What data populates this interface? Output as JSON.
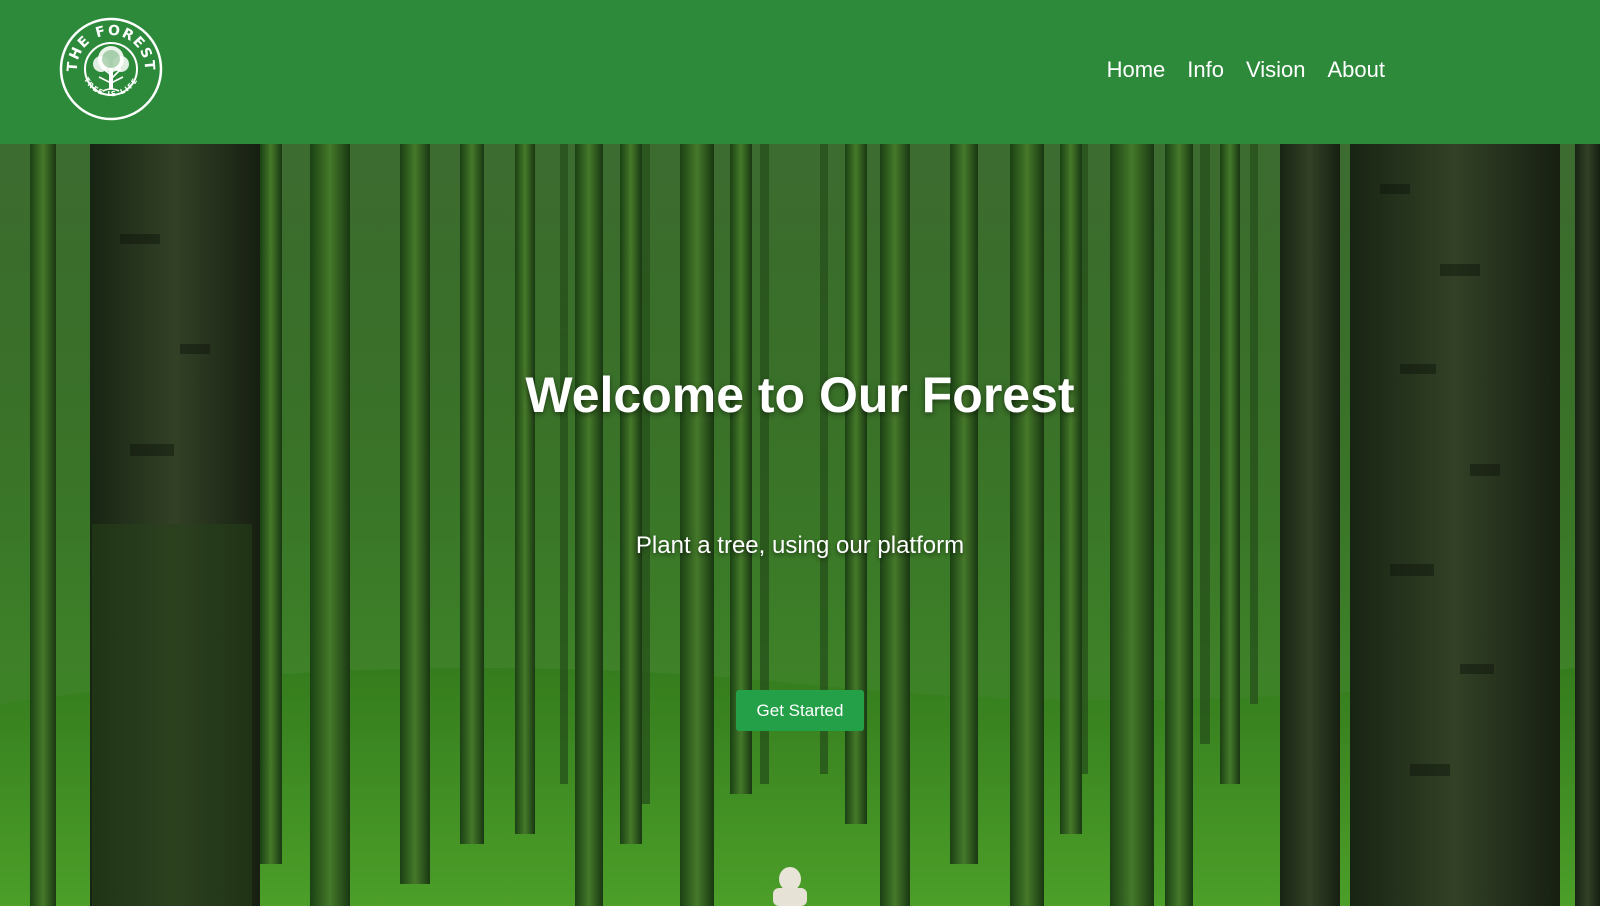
{
  "brand": {
    "logo_top_text": "THE FOREST",
    "logo_bottom_text": "TREE IS LIFE",
    "logo_icon": "tree-icon"
  },
  "nav": {
    "items": [
      {
        "label": "Home"
      },
      {
        "label": "Info"
      },
      {
        "label": "Vision"
      },
      {
        "label": "About"
      }
    ]
  },
  "hero": {
    "title": "Welcome to Our Forest",
    "subtitle": "Plant a tree, using our platform",
    "cta_label": "Get Started",
    "background": "forest-photo"
  },
  "colors": {
    "navbar": "#2d8a3a",
    "cta": "#24a148",
    "text": "#ffffff"
  }
}
